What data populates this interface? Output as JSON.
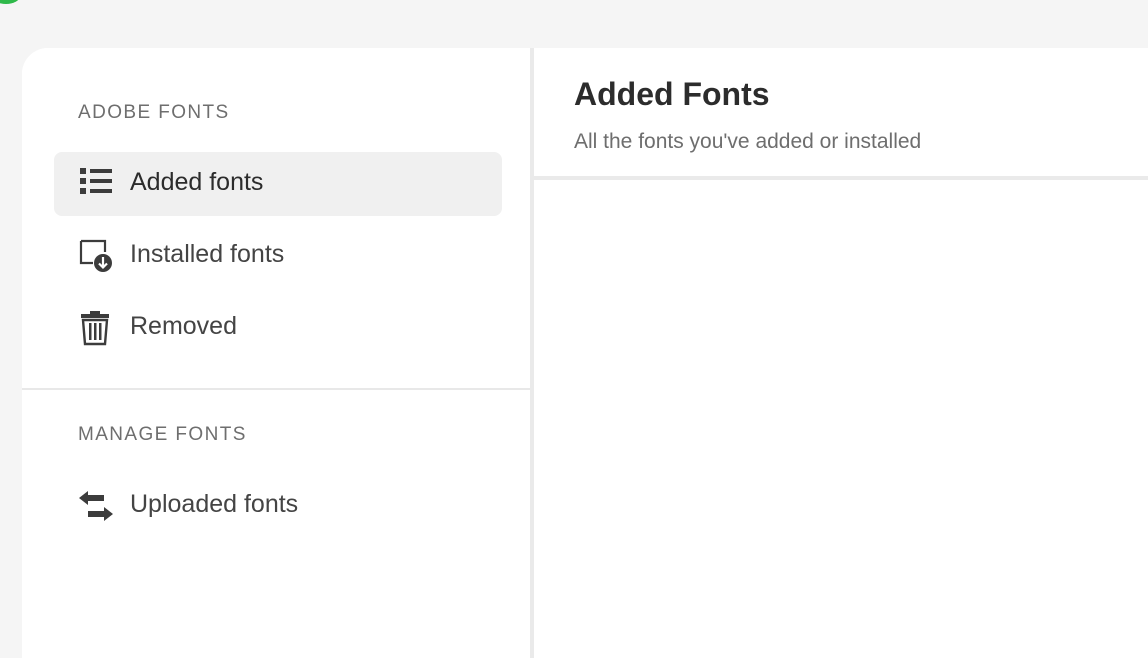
{
  "sidebar": {
    "sections": [
      {
        "heading": "ADOBE FONTS",
        "items": [
          {
            "label": "Added fonts",
            "icon": "list-icon",
            "active": true
          },
          {
            "label": "Installed fonts",
            "icon": "installed-download-icon",
            "active": false
          },
          {
            "label": "Removed",
            "icon": "trash-icon",
            "active": false
          }
        ]
      },
      {
        "heading": "MANAGE FONTS",
        "items": [
          {
            "label": "Uploaded fonts",
            "icon": "swap-arrows-icon",
            "active": false
          }
        ]
      }
    ]
  },
  "main": {
    "title": "Added Fonts",
    "subtitle": "All the fonts you've added or installed"
  },
  "colors": {
    "status_dot": "#2fb94a",
    "active_item_bg": "#f0f0f0",
    "text_primary": "#2c2c2c",
    "text_secondary": "#6e6e6e"
  }
}
